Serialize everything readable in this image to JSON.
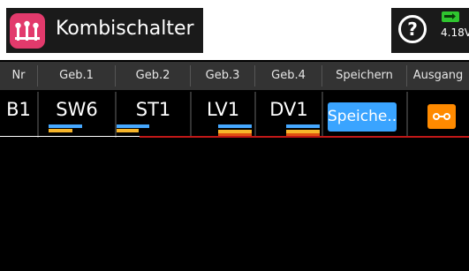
{
  "header": {
    "title": "Kombischalter",
    "app_icon": "mixer-sliders-icon",
    "help_icon": "help-question-icon",
    "help_symbol": "?",
    "battery": {
      "icon": "battery-charging-icon",
      "voltage": "4.18V"
    }
  },
  "table": {
    "columns": [
      "Nr",
      "Geb.1",
      "Geb.2",
      "Geb.3",
      "Geb.4",
      "Speichern",
      "Ausgang"
    ],
    "row": {
      "nr": "B1",
      "geb1": "SW6",
      "geb2": "ST1",
      "geb3": "LV1",
      "geb4": "DV1",
      "save_label": "Speiche..",
      "output_icon": "switch-open-icon"
    }
  },
  "colors": {
    "accent_pink": "#e23a6c",
    "accent_blue": "#3aa4ff",
    "accent_orange": "#ff8a00",
    "indicator_yellow": "#f7b52a",
    "battery_green": "#2fc62f"
  }
}
